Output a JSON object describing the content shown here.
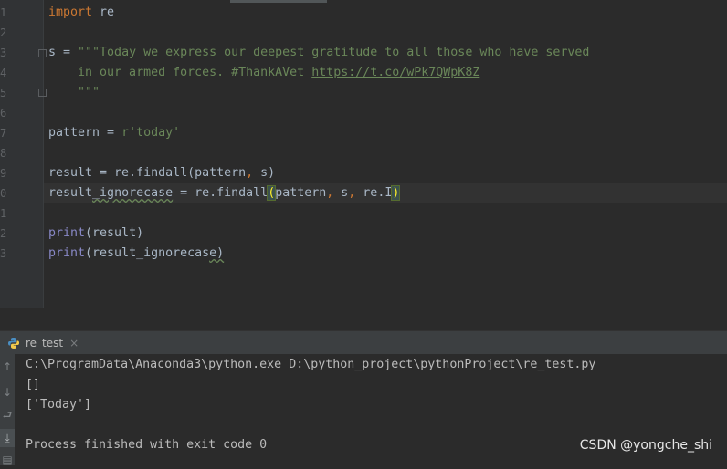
{
  "editor": {
    "line_numbers": [
      "1",
      "2",
      "3",
      "4",
      "5",
      "6",
      "7",
      "8",
      "9",
      "0",
      "1",
      "2",
      "3"
    ],
    "code": {
      "l1_kw": "import",
      "l1_rest": " re",
      "l3_var": "s = ",
      "l3_str": "\"\"\"Today we express our deepest gratitude to all those who have served",
      "l4_str": "    in our armed forces. #ThankAVet ",
      "l4_url": "https://t.co/wPk7QWpK8Z",
      "l5_str": "    \"\"\"",
      "l7_var": "pattern = ",
      "l7_str": "r'today'",
      "l9_a": "result = re.findall(pattern",
      "l9_comma": ",",
      "l9_b": " s)",
      "l10_a": "result",
      "l10_squig": "_ignorecase",
      "l10_b": " = re.findall",
      "l10_open": "(",
      "l10_c": "pattern",
      "l10_comma1": ",",
      "l10_d": " s",
      "l10_comma2": ",",
      "l10_e": " re.I",
      "l10_close": ")",
      "l12_fn": "print",
      "l12_rest": "(result)",
      "l13_fn": "print",
      "l13_a": "(result_ignorecas",
      "l13_squig": "e)"
    }
  },
  "run_panel": {
    "tab_label": "re_test",
    "close_glyph": "×",
    "icon": "python-icon",
    "toolbar_icons": [
      "arrow-up-icon",
      "arrow-down-icon",
      "soft-wrap-icon",
      "scroll-to-end-icon",
      "print-icon"
    ],
    "output": [
      "C:\\ProgramData\\Anaconda3\\python.exe D:\\python_project\\pythonProject\\re_test.py",
      "[]",
      "['Today']",
      "",
      "Process finished with exit code 0"
    ]
  },
  "watermark": "CSDN @yongche_shi",
  "colors": {
    "editor_bg": "#2b2b2b",
    "keyword": "#cc7832",
    "string": "#6a8759",
    "builtin": "#8888c6",
    "text": "#a9b7c6"
  }
}
